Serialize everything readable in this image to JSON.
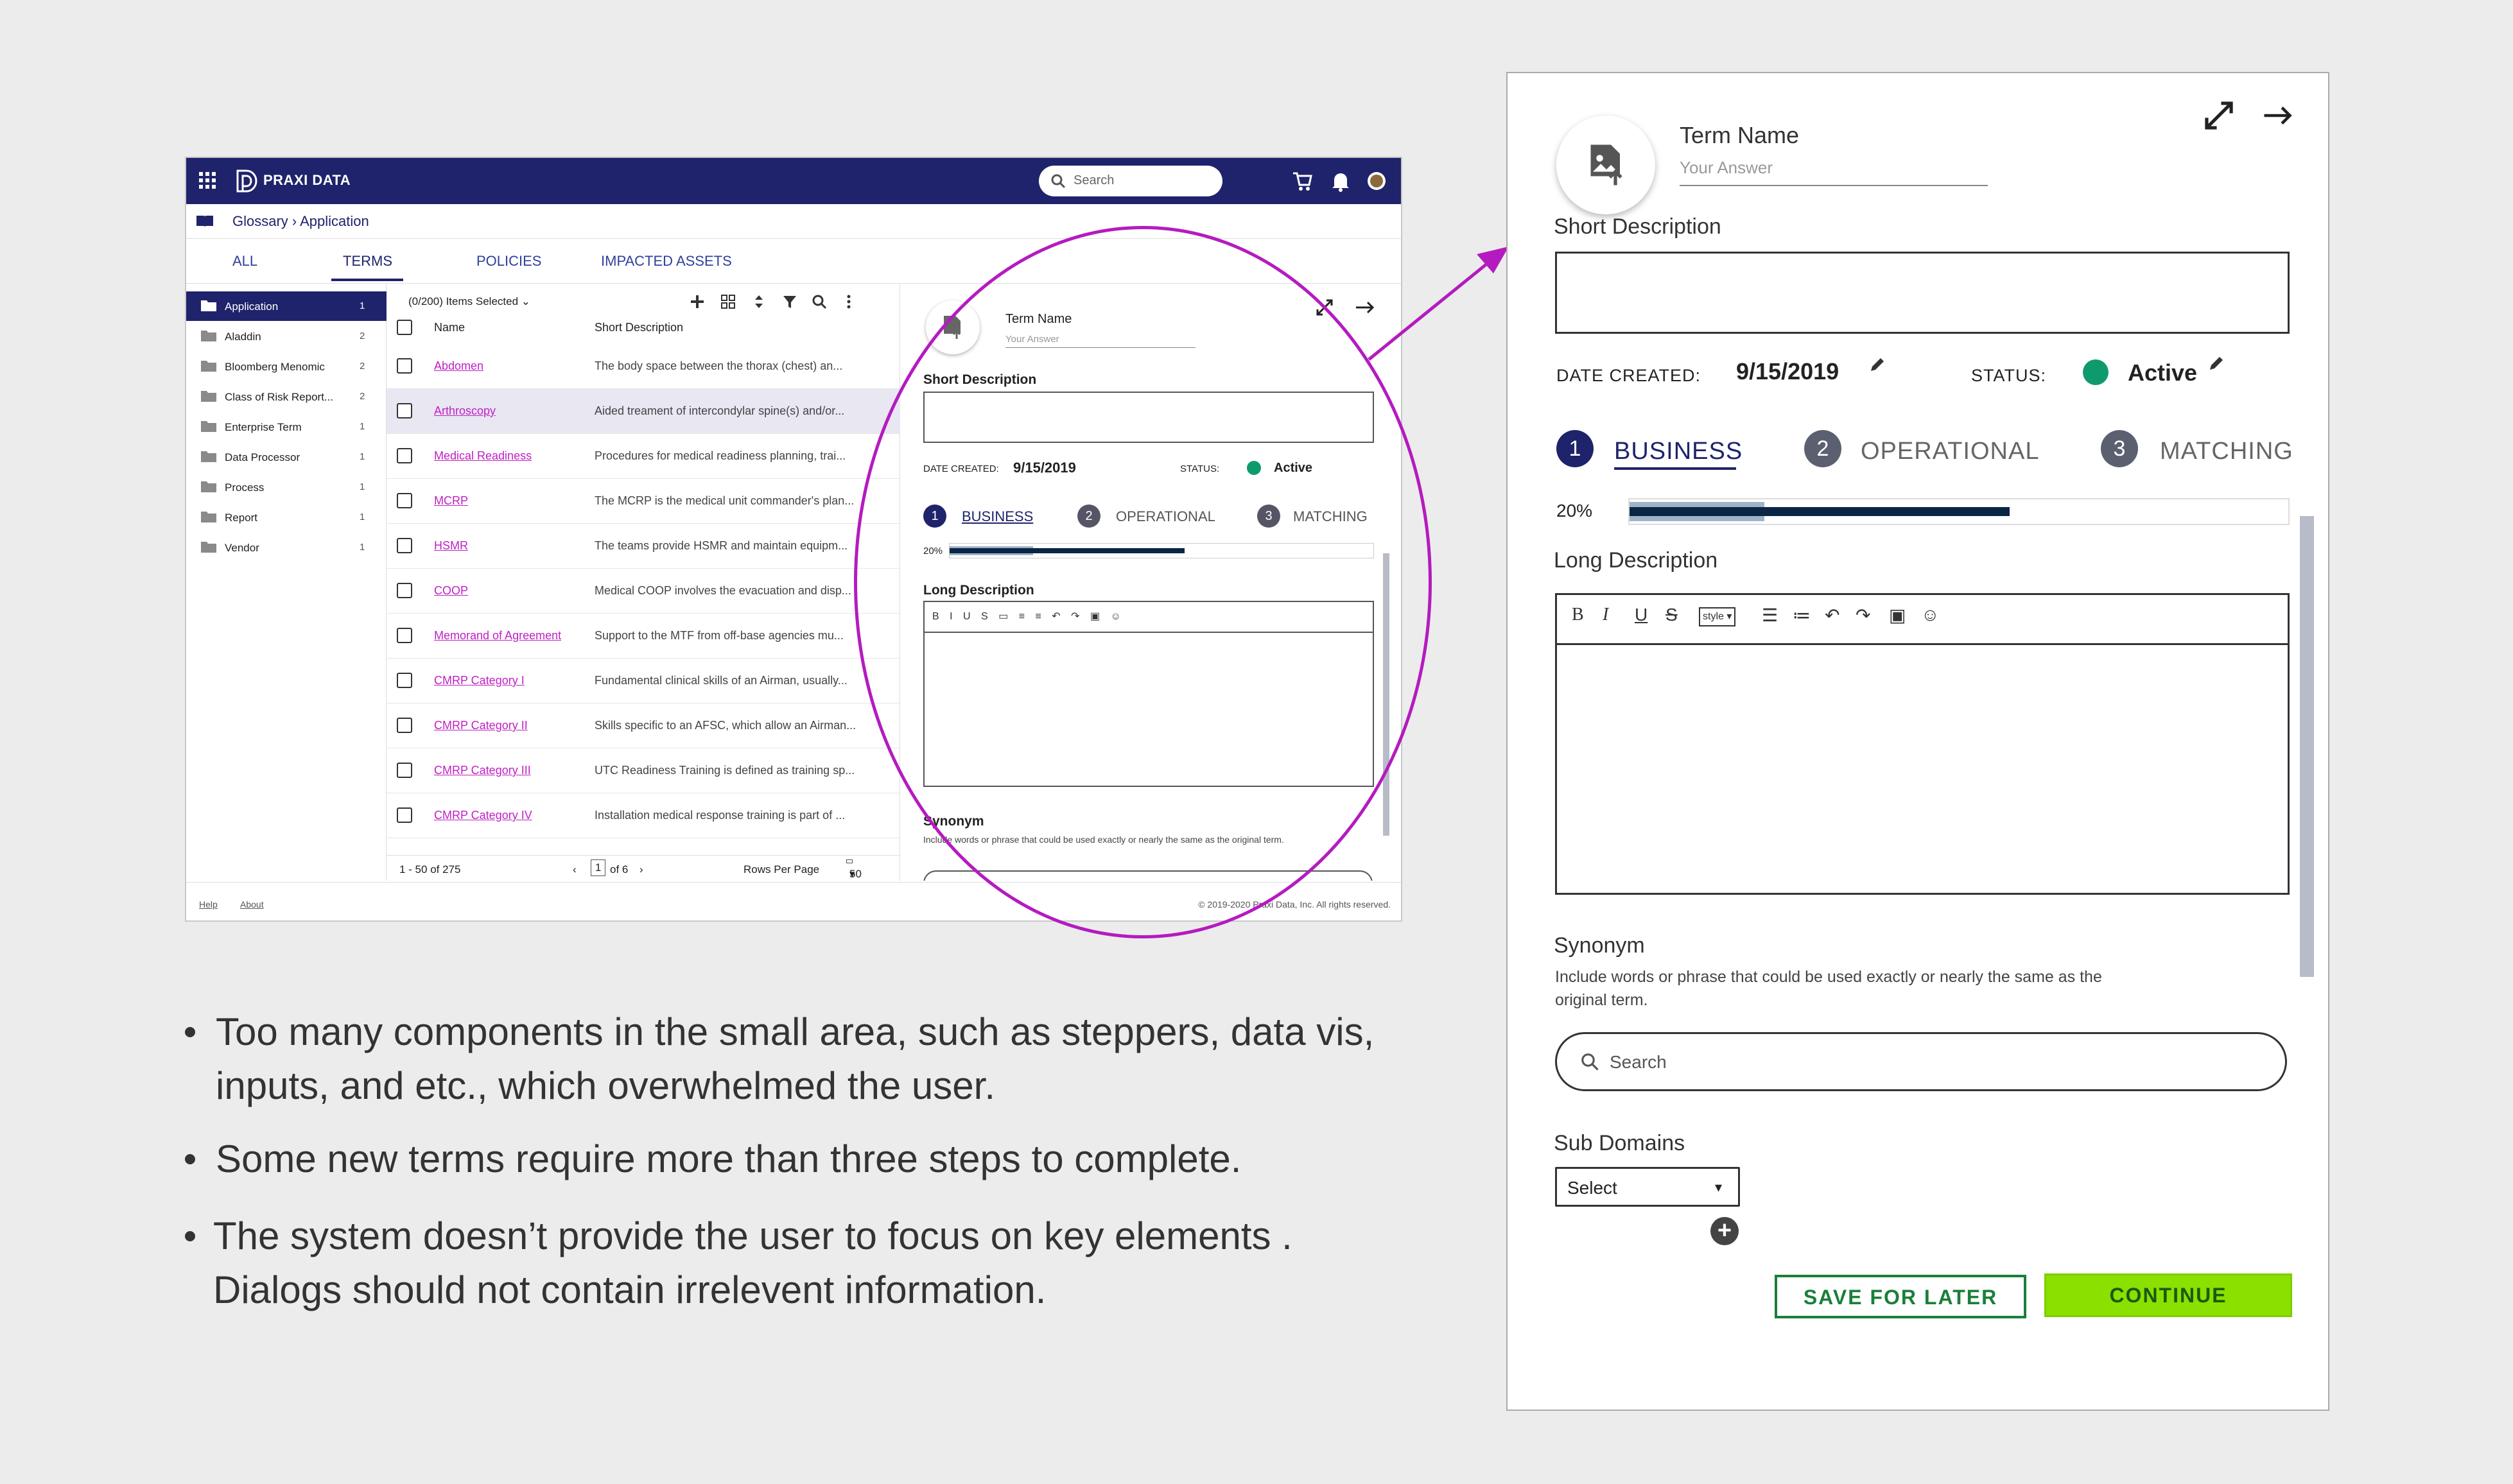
{
  "app": {
    "brand": "PRAXI DATA",
    "search_placeholder": "Search",
    "breadcrumb": "Glossary › Application",
    "tabs": [
      {
        "label": "ALL"
      },
      {
        "label": "TERMS"
      },
      {
        "label": "POLICIES"
      },
      {
        "label": "IMPACTED ASSETS"
      }
    ],
    "sidebar": [
      {
        "name": "Application",
        "count": "1"
      },
      {
        "name": "Aladdin",
        "count": "2"
      },
      {
        "name": "Bloomberg  Menomic",
        "count": "2"
      },
      {
        "name": "Class of Risk Report...",
        "count": "2"
      },
      {
        "name": "Enterprise Term",
        "count": "1"
      },
      {
        "name": "Data Processor",
        "count": "1"
      },
      {
        "name": "Process",
        "count": "1"
      },
      {
        "name": "Report",
        "count": "1"
      },
      {
        "name": "Vendor",
        "count": "1"
      }
    ],
    "table": {
      "selected_label": "(0/200) Items Selected",
      "col_name": "Name",
      "col_desc": "Short Description",
      "rows": [
        {
          "name": "Abdomen",
          "desc": "The body space between the thorax (chest) an..."
        },
        {
          "name": "Arthroscopy",
          "desc": "Aided treament of intercondylar spine(s) and/or..."
        },
        {
          "name": "Medical Readiness",
          "desc": "Procedures for medical readiness planning, trai..."
        },
        {
          "name": "MCRP",
          "desc": "The MCRP is the medical unit commander's plan..."
        },
        {
          "name": "HSMR",
          "desc": "The teams provide HSMR and maintain equipm..."
        },
        {
          "name": "COOP",
          "desc": "Medical COOP involves the evacuation and disp..."
        },
        {
          "name": "Memorand of Agreement",
          "desc": "Support to the MTF from off-base agencies mu..."
        },
        {
          "name": "CMRP Category I",
          "desc": "Fundamental clinical skills of an Airman, usually..."
        },
        {
          "name": "CMRP Category II",
          "desc": "Skills specific to an AFSC, which allow an Airman..."
        },
        {
          "name": "CMRP Category III",
          "desc": "UTC Readiness Training is defined as training sp..."
        },
        {
          "name": "CMRP Category IV",
          "desc": "Installation medical response training is part of ..."
        }
      ],
      "range": "1 - 50 of 275",
      "page": "1",
      "of_pages": "of 6",
      "rows_per_page_label": "Rows Per Page",
      "rows_per_page": "50"
    },
    "footer": {
      "help": "Help",
      "about": "About",
      "copyright": "© 2019-2020 Praxi Data, Inc. All rights reserved."
    },
    "mini_form": {
      "term_name": "Term Name",
      "your_answer": "Your Answer",
      "short_desc": "Short Description",
      "date_created_label": "DATE CREATED:",
      "date_created": "9/15/2019",
      "status_label": "STATUS:",
      "status": "Active",
      "steps": [
        "BUSINESS",
        "OPERATIONAL",
        "MATCHING"
      ],
      "progress_label": "20%",
      "long_desc": "Long Description",
      "synonym": "Synonym",
      "synonym_help": "Include words or phrase that could be used exactly or nearly the same as the original term."
    }
  },
  "bullets": [
    "Too many components in the small area, such as steppers, data vis, inputs, and etc., which overwhelmed the user.",
    "Some new terms require more than three steps to complete.",
    "The system doesn’t provide the user to focus on key elements . Dialogs should not contain irrelevent information."
  ],
  "panel": {
    "term_name": "Term Name",
    "your_answer": "Your Answer",
    "short_desc": "Short Description",
    "date_created_label": "DATE CREATED:",
    "date_created": "9/15/2019",
    "status_label": "STATUS:",
    "status": "Active",
    "steps": [
      {
        "num": "1",
        "label": "BUSINESS"
      },
      {
        "num": "2",
        "label": "OPERATIONAL"
      },
      {
        "num": "3",
        "label": "MATCHING"
      }
    ],
    "progress_label": "20%",
    "progress": 0.2,
    "long_desc": "Long Description",
    "synonym": "Synonym",
    "synonym_help_1": "Include words or phrase that could be used exactly or nearly the same as the",
    "synonym_help_2": "original term.",
    "search_placeholder": "Search",
    "sub_domains": "Sub Domains",
    "select": "Select",
    "save_for_later": "SAVE FOR LATER",
    "continue": "CONTINUE"
  },
  "colors": {
    "navy": "#1f236b",
    "annotation": "#b41bbf",
    "status_green": "#0f9a6e",
    "continue_green": "#8be000",
    "save_green": "#1a7f3a",
    "progress_dark": "#0b2544",
    "progress_light": "#9eb4c9"
  }
}
